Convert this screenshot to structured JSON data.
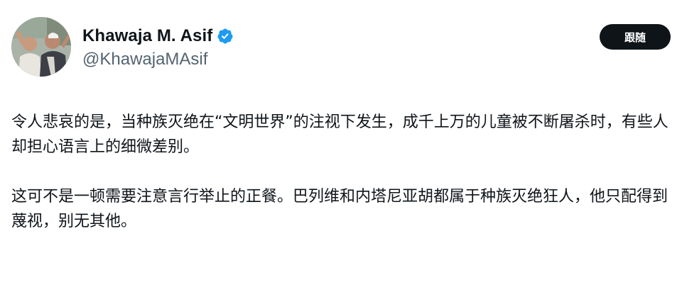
{
  "author": {
    "display_name": "Khawaja M. Asif",
    "handle": "@KhawajaMAsif",
    "avatar_icon": "profile-photo",
    "verified_icon": "verified-badge-icon",
    "verified_color": "#1d9bf0"
  },
  "follow_button": {
    "label": "跟随"
  },
  "tweet": {
    "paragraphs": [
      "令人悲哀的是，当种族灭绝在“文明世界”的注视下发生，成千上万的儿童被不断屠杀时，有些人却担心语言上的细微差别。",
      "这可不是一顿需要注意言行举止的正餐。巴列维和内塔尼亚胡都属于种族灭绝狂人，他只配得到蔑视，别无其他。"
    ]
  },
  "colors": {
    "text": "#0f1419",
    "secondary": "#536471",
    "button_bg": "#0f1419",
    "button_text": "#ffffff"
  }
}
